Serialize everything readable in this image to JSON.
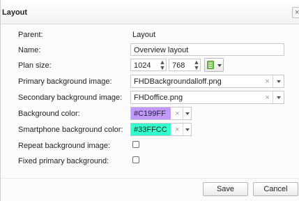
{
  "dialog": {
    "title": "Layout",
    "close_glyph": "×"
  },
  "form": {
    "parent": {
      "label": "Parent:",
      "value": "Layout"
    },
    "name": {
      "label": "Name:",
      "value": "Overview layout"
    },
    "plan_size": {
      "label": "Plan size:",
      "width": "1024",
      "height": "768",
      "spin_up": "▲",
      "spin_down": "▼"
    },
    "primary_bg": {
      "label": "Primary background image:",
      "value": "FHDBackgroundalloff.png",
      "clear_glyph": "×"
    },
    "secondary_bg": {
      "label": "Secondary background image:",
      "value": "FHDoffice.png",
      "clear_glyph": "×"
    },
    "bg_color": {
      "label": "Background color:",
      "value": "#C199FF",
      "swatch": "#C199FF",
      "clear_glyph": "×"
    },
    "phone_bg_color": {
      "label": "Smartphone background color:",
      "value": "#33FFCC",
      "swatch": "#33FFCC",
      "clear_glyph": "×"
    },
    "repeat_bg": {
      "label": "Repeat background image:",
      "checked": false
    },
    "fixed_primary_bg": {
      "label": "Fixed primary background:",
      "checked": false
    }
  },
  "buttons": {
    "save": "Save",
    "cancel": "Cancel"
  },
  "icons": {
    "plan_size_menu": "spreadsheet-icon"
  }
}
